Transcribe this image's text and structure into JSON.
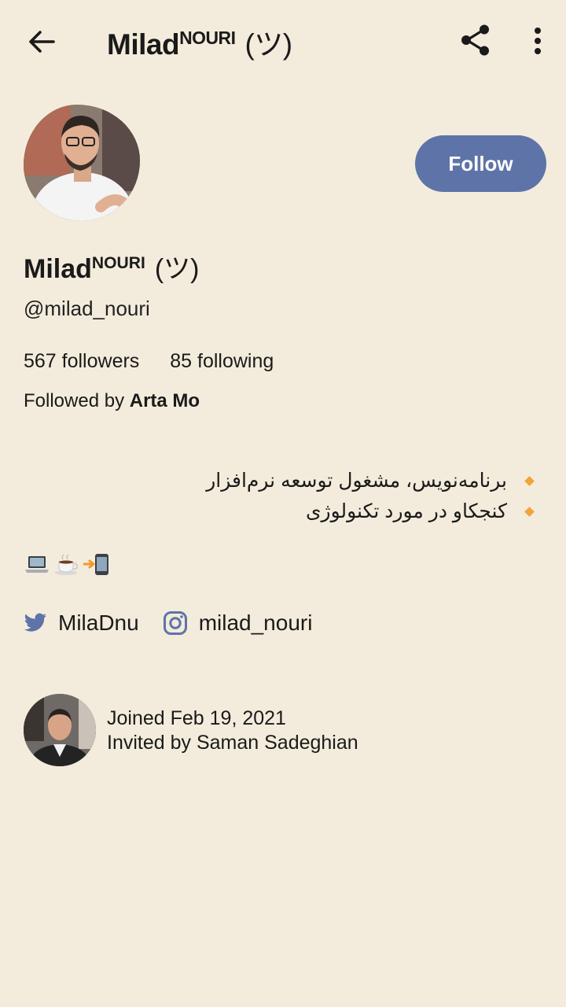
{
  "header": {
    "title_name": "Milad",
    "title_super": "NOURI",
    "title_suffix": "(ツ)"
  },
  "profile": {
    "name": "Milad",
    "name_super": "NOURI",
    "name_suffix": "(ツ)",
    "handle": "@milad_nouri",
    "followers": "567 followers",
    "following": "85 following",
    "followed_by_prefix": "Followed by",
    "followed_by_name": "Arta Mo",
    "follow_label": "Follow"
  },
  "bio": {
    "lines": [
      "برنامه‌نویس، مشغول توسعه نرم‌افزار",
      "کنجکاو در مورد تکنولوژی"
    ],
    "emoji_icons": [
      "laptop-icon",
      "coffee-icon",
      "phone-arrow-icon"
    ]
  },
  "socials": {
    "twitter": "MilaDnu",
    "instagram": "milad_nouri"
  },
  "joined": {
    "date": "Joined Feb 19, 2021",
    "invited_by": "Invited by Saman Sadeghian"
  },
  "colors": {
    "background": "#F3ECDC",
    "follow_button": "#5E74A8",
    "bullet": "#F2A33A",
    "social_icon": "#5E74A8"
  }
}
